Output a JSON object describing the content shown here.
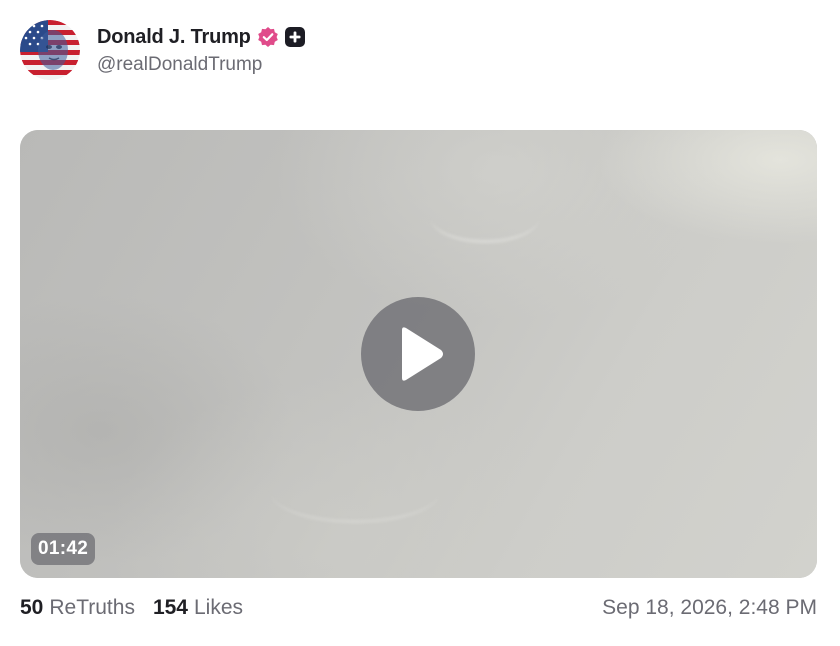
{
  "author": {
    "display_name": "Donald J. Trump",
    "handle": "@realDonaldTrump",
    "avatar_icon": "flag-portrait-avatar",
    "verified_icon": "verified-badge-icon",
    "verified_color": "#e04b8a",
    "plus_icon": "plus-badge-icon"
  },
  "media": {
    "type": "video",
    "duration": "01:42",
    "play_icon": "play-icon"
  },
  "stats": {
    "retruths_count": "50",
    "retruths_label": "ReTruths",
    "likes_count": "154",
    "likes_label": "Likes"
  },
  "timestamp": "Sep 18, 2026, 2:48 PM"
}
